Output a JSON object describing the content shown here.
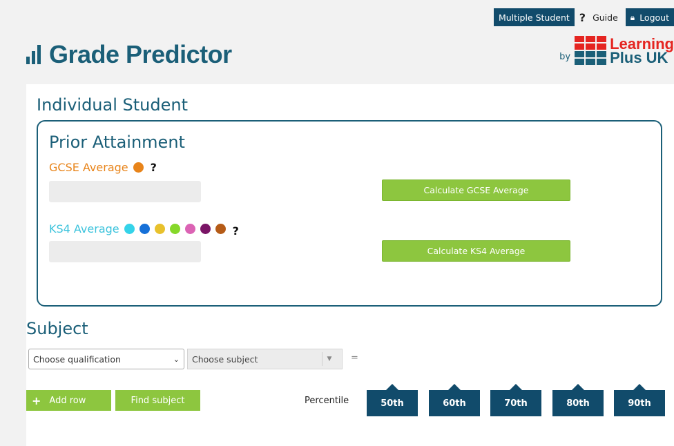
{
  "topbar": {
    "multiple_student": "Multiple Student",
    "guide": "Guide",
    "logout": "Logout"
  },
  "brand": {
    "title": "Grade Predictor"
  },
  "partner": {
    "by": "by",
    "line1": "Learning",
    "line2": "Plus UK"
  },
  "individual": {
    "title": "Individual Student"
  },
  "prior": {
    "title": "Prior Attainment",
    "gcse_label": "GCSE Average",
    "gcse_dot_color": "#e8841a",
    "ks4_label": "KS4 Average",
    "ks4_dot_colors": [
      "#35d3e9",
      "#1670d8",
      "#e8c12c",
      "#86d82a",
      "#db63b4",
      "#7a1566",
      "#b55b17"
    ],
    "calc_gcse": "Calculate GCSE Average",
    "calc_ks4": "Calculate KS4 Average",
    "help": "?"
  },
  "subject": {
    "title": "Subject",
    "qualification_placeholder": "Choose qualification",
    "subject_placeholder": "Choose subject",
    "equals": "=",
    "add_row": "Add row",
    "find_subject": "Find subject",
    "percentile_label": "Percentile",
    "percentiles": [
      "50th",
      "60th",
      "70th",
      "80th",
      "90th"
    ]
  },
  "colors": {
    "primary": "#1b5f78",
    "dark_navy": "#114b6b",
    "green": "#8dc63f",
    "brand_red": "#e52521"
  }
}
